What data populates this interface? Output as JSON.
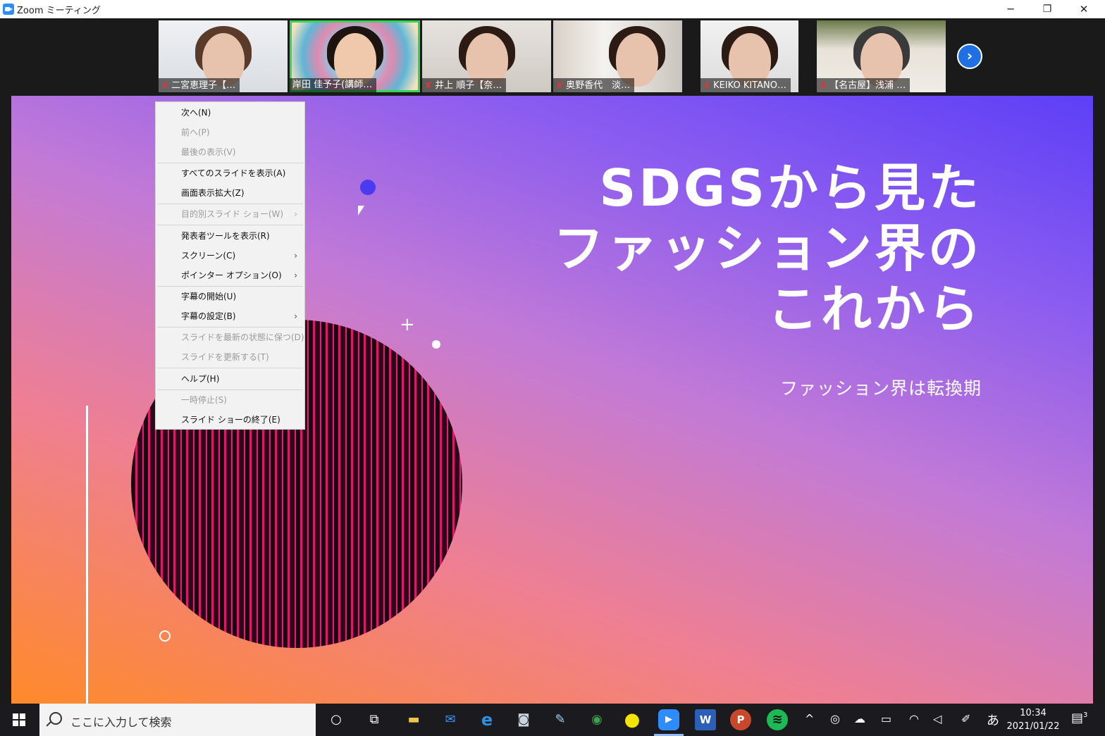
{
  "window": {
    "title": "Zoom ミーティング",
    "controls": {
      "minimize": "─",
      "restore": "❐",
      "close": "✕"
    }
  },
  "participants": [
    {
      "name": "二宮恵理子【…",
      "muted": true
    },
    {
      "name": "岸田 佳予子(講師…",
      "muted": false,
      "active": true
    },
    {
      "name": "井上 順子【奈…",
      "muted": true
    },
    {
      "name": "奥野香代　淡…",
      "muted": true
    },
    {
      "name": "KEIKO KITANO…",
      "muted": true
    },
    {
      "name": "【名古屋】浅浦 …",
      "muted": true
    }
  ],
  "strip": {
    "next_icon": "chevron-right-icon",
    "next_glyph": "›"
  },
  "slide": {
    "title": "SDGSから見た\nファッション界の\nこれから",
    "subtitle": "ファッション界は転換期",
    "colors": {
      "pink": "#f0187a",
      "blue_dot": "#4a3af0"
    }
  },
  "context_menu": {
    "items": [
      {
        "label": "次へ(N)",
        "enabled": true
      },
      {
        "label": "前へ(P)",
        "enabled": false
      },
      {
        "label": "最後の表示(V)",
        "enabled": false
      },
      {
        "label": "すべてのスライドを表示(A)",
        "enabled": true
      },
      {
        "label": "画面表示拡大(Z)",
        "enabled": true
      },
      {
        "label": "目的別スライド ショー(W)",
        "enabled": false,
        "submenu": true
      },
      {
        "label": "発表者ツールを表示(R)",
        "enabled": true
      },
      {
        "label": "スクリーン(C)",
        "enabled": true,
        "submenu": true
      },
      {
        "label": "ポインター オプション(O)",
        "enabled": true,
        "submenu": true
      },
      {
        "label": "字幕の開始(U)",
        "enabled": true
      },
      {
        "label": "字幕の設定(B)",
        "enabled": true,
        "submenu": true
      },
      {
        "label": "スライドを最新の状態に保つ(D)",
        "enabled": false
      },
      {
        "label": "スライドを更新する(T)",
        "enabled": false
      },
      {
        "label": "ヘルプ(H)",
        "enabled": true
      },
      {
        "label": "一時停止(S)",
        "enabled": false
      },
      {
        "label": "スライド ショーの終了(E)",
        "enabled": true
      }
    ],
    "submenu_glyph": "›"
  },
  "taskbar": {
    "search_placeholder": "ここに入力して検索",
    "apps": [
      {
        "icon": "cortana-icon",
        "glyph": "○"
      },
      {
        "icon": "task-view-icon",
        "glyph": "⧉"
      },
      {
        "icon": "file-explorer-icon",
        "glyph": "▬"
      },
      {
        "icon": "mail-icon",
        "glyph": "✉"
      },
      {
        "icon": "edge-icon",
        "glyph": "e"
      },
      {
        "icon": "camera-icon",
        "glyph": "◙"
      },
      {
        "icon": "paint-icon",
        "glyph": "✎"
      },
      {
        "icon": "chrome-icon",
        "glyph": "◉"
      },
      {
        "icon": "sticky-icon",
        "glyph": "●"
      },
      {
        "icon": "zoom-icon",
        "glyph": "▶"
      },
      {
        "icon": "word-icon",
        "glyph": "W"
      },
      {
        "icon": "powerpoint-icon",
        "glyph": "P"
      },
      {
        "icon": "spotify-icon",
        "glyph": "≋"
      }
    ],
    "tray": [
      {
        "icon": "chevron-up-icon",
        "glyph": "^"
      },
      {
        "icon": "meet-now-icon",
        "glyph": "◎"
      },
      {
        "icon": "onedrive-icon",
        "glyph": "☁"
      },
      {
        "icon": "battery-icon",
        "glyph": "▭"
      },
      {
        "icon": "wifi-icon",
        "glyph": "◠"
      },
      {
        "icon": "volume-icon",
        "glyph": "◁"
      },
      {
        "icon": "pen-icon",
        "glyph": "✐"
      }
    ],
    "ime": "あ",
    "time": "10:34",
    "date": "2021/01/22",
    "notification_count": "3"
  }
}
